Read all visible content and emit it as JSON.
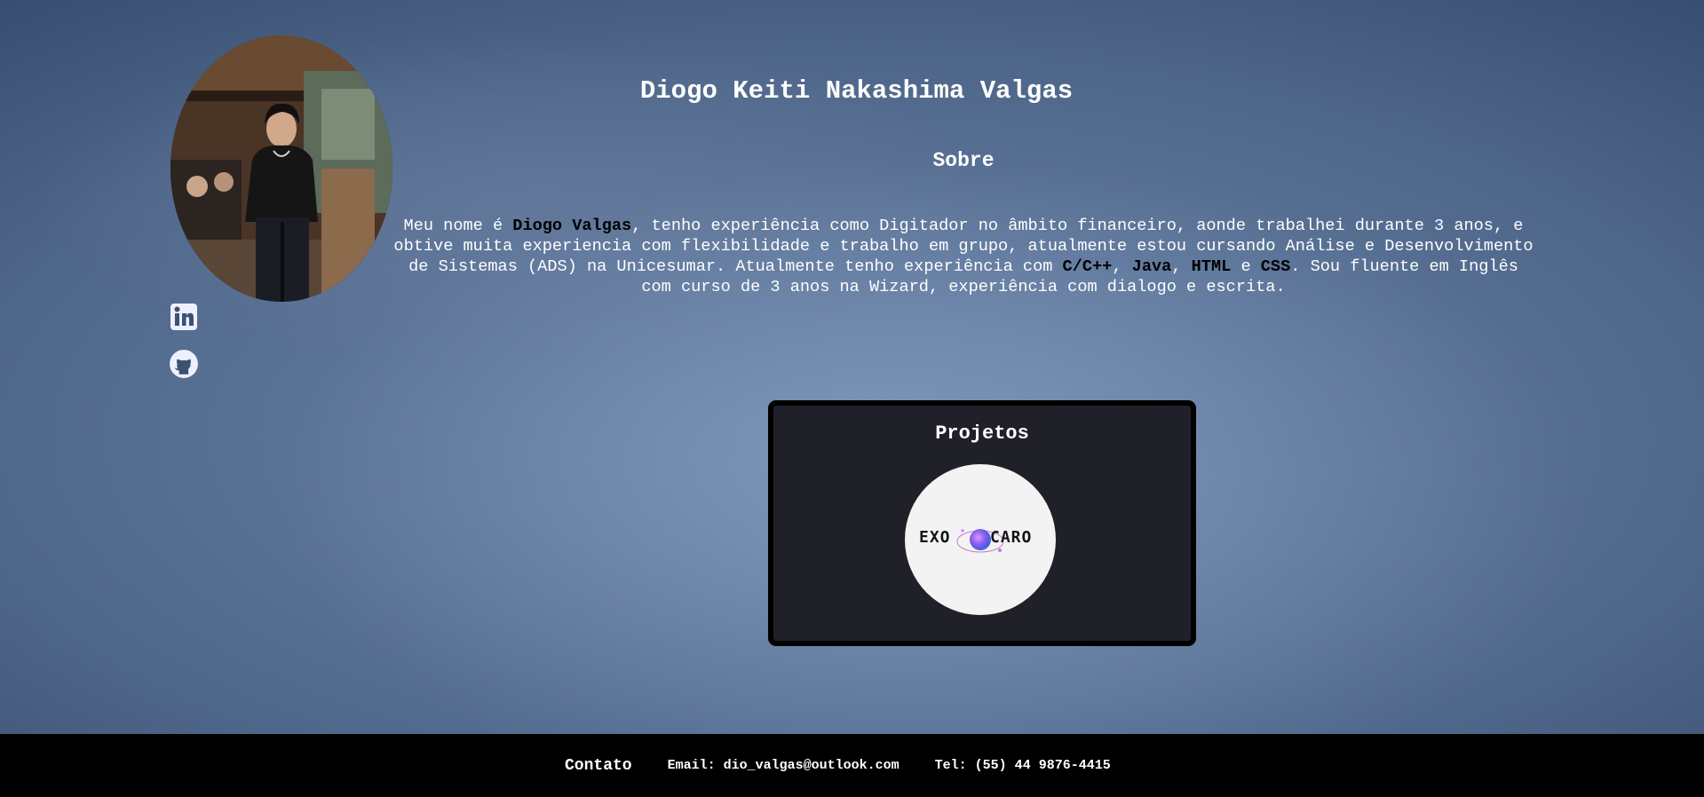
{
  "profile": {
    "name": "Diogo Keiti Nakashima Valgas",
    "photo_alt": "Profile photo"
  },
  "social": {
    "linkedin_icon": "linkedin-icon",
    "github_icon": "github-icon"
  },
  "about": {
    "title": "Sobre",
    "intro": "Meu nome é ",
    "name_highlight": "Diogo Valgas",
    "body1": ", tenho experiência como Digitador no âmbito financeiro, aonde trabalhei durante 3 anos, e obtive muita experiencia com flexibilidade e trabalho em grupo, atualmente estou cursando Análise e Desenvolvimento de Sistemas (ADS) na Unicesumar. Atualmente tenho experiência com ",
    "skill1": "C/C++",
    "sep1": ", ",
    "skill2": "Java",
    "sep2": ", ",
    "skill3": "HTML",
    "sep3": " e ",
    "skill4": "CSS",
    "body2": ". Sou fluente em Inglês com curso de 3 anos na Wizard, experiência com dialogo e escrita."
  },
  "projects": {
    "title": "Projetos",
    "items": [
      {
        "logo_left": "EXO",
        "logo_right": "CARO"
      }
    ]
  },
  "footer": {
    "title": "Contato",
    "email": "Email: dio_valgas@outlook.com",
    "phone": "Tel: (55) 44 9876-4415"
  },
  "colors": {
    "background": "#4d6588",
    "card": "#1f2028",
    "footer": "#000000",
    "text": "#ffffff",
    "highlight": "#000000"
  }
}
